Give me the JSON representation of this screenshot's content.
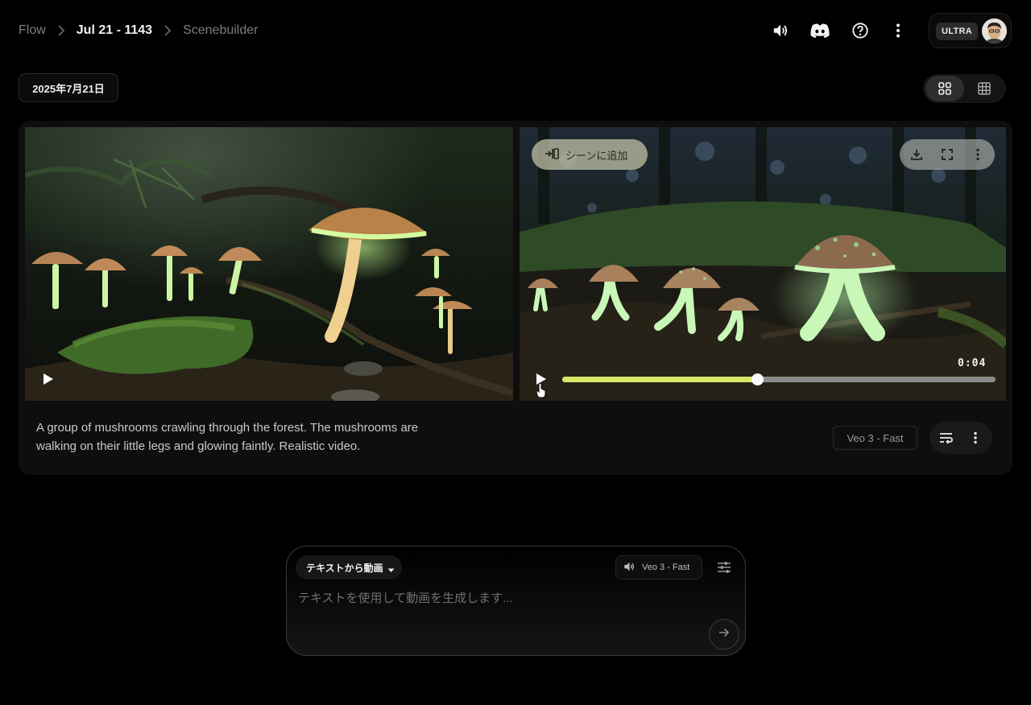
{
  "breadcrumb": {
    "items": [
      {
        "label": "Flow"
      },
      {
        "label": "Jul 21 - 1143"
      },
      {
        "label": "Scenebuilder"
      }
    ]
  },
  "header": {
    "icons": [
      "speaker-icon",
      "discord-icon",
      "help-icon",
      "more-vert-icon"
    ],
    "account": {
      "plan_badge": "ULTRA"
    }
  },
  "date_chip": "2025年7月21日",
  "view_toggle": {
    "options": [
      "grid-large-icon",
      "grid-small-icon"
    ],
    "active": "grid-large-icon"
  },
  "generation": {
    "prompt": "A group of mushrooms crawling through the forest. The mushrooms are walking on their little legs and glowing faintly. Realistic video.",
    "model": "Veo 3 - Fast",
    "videos": [
      {
        "state": "paused"
      },
      {
        "state": "hovered",
        "add_scene_label": "シーンに追加",
        "tools": [
          "download-icon",
          "fullscreen-icon",
          "more-vert-icon"
        ],
        "timecode": "0:04",
        "progress": 0.45
      }
    ]
  },
  "composer": {
    "mode": "テキストから動画",
    "model": "Veo 3 - Fast",
    "placeholder": "テキストを使用して動画を生成します..."
  },
  "colors": {
    "background": "#000000",
    "card": "#0e0e0e",
    "accent_progress": "#d8e86a",
    "mushroom_glow": "#b8f5a0",
    "text_muted": "#7d7d7d"
  }
}
